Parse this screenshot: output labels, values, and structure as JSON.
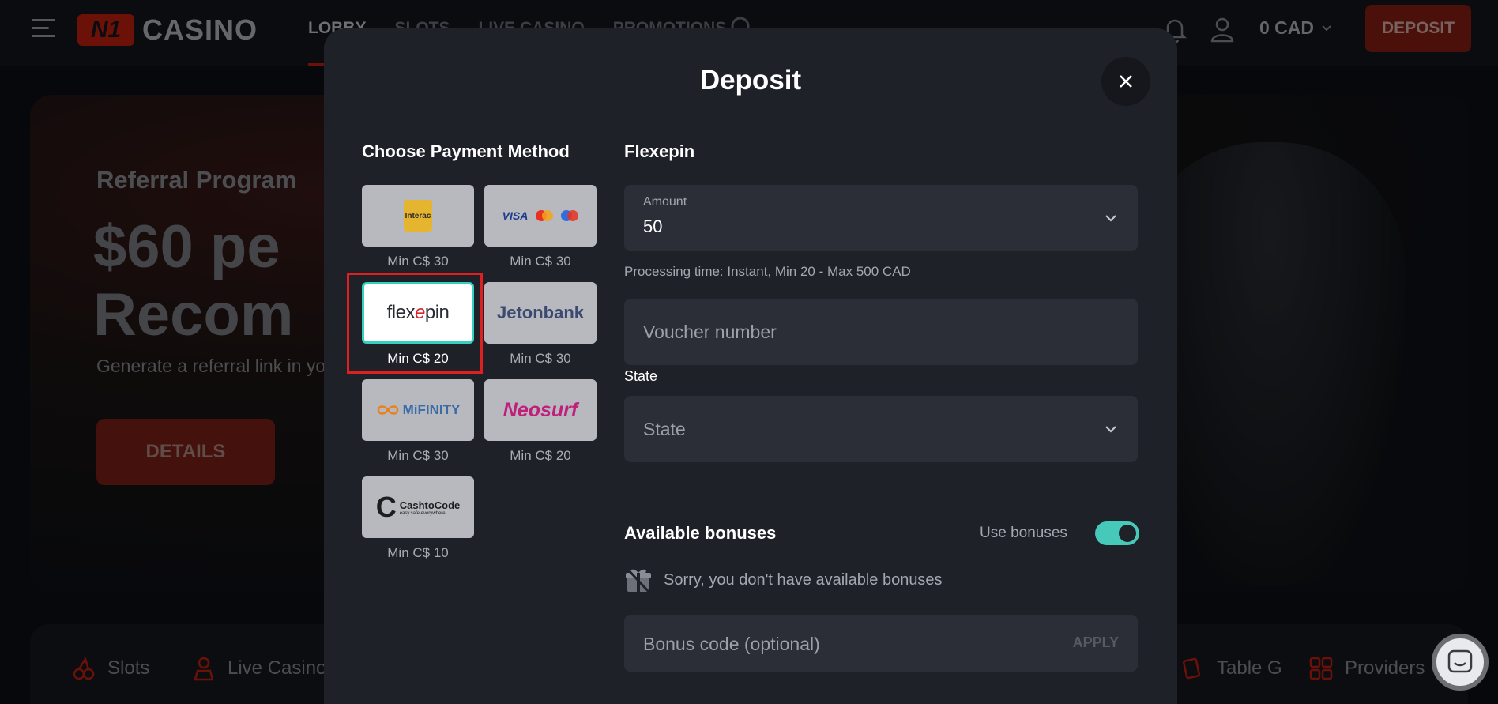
{
  "header": {
    "brand_badge": "N1",
    "brand_text": "CASINO",
    "nav": [
      "LOBBY",
      "SLOTS",
      "LIVE CASINO",
      "PROMOTIONS"
    ],
    "balance": "0 CAD",
    "deposit_label": "DEPOSIT"
  },
  "hero": {
    "kicker": "Referral Program",
    "headline_line1": "$60 pe",
    "headline_line2": "Recom",
    "subtitle": "Generate a referral link in yo",
    "button": "DETAILS"
  },
  "categories": [
    "Slots",
    "Live Casino",
    "Table G",
    "Providers"
  ],
  "modal": {
    "title": "Deposit",
    "choose_title": "Choose Payment Method",
    "methods": [
      {
        "name": "Interac",
        "logo_text": "Interac",
        "min": "Min C$ 30"
      },
      {
        "name": "Visa / Mastercard / Maestro",
        "logo_text": "VISA",
        "min": "Min C$ 30"
      },
      {
        "name": "Flexepin",
        "logo_text_a": "flex",
        "logo_text_b": "e",
        "logo_text_c": "pin",
        "min": "Min C$ 20",
        "selected": true
      },
      {
        "name": "Jetonbank",
        "logo_text": "Jetonbank",
        "min": "Min C$ 30"
      },
      {
        "name": "MiFinity",
        "logo_text": "MiFINITY",
        "min": "Min C$ 30"
      },
      {
        "name": "Neosurf",
        "logo_text": "Neosurf",
        "min": "Min C$ 20"
      },
      {
        "name": "CashtoCode",
        "logo_text": "CashtoCode",
        "logo_sub": "easy.safe.everywhere",
        "min": "Min C$ 10"
      }
    ],
    "method_title": "Flexepin",
    "amount": {
      "label": "Amount",
      "value": "50"
    },
    "processing_time": "Processing time: Instant, Min 20 - Max 500 CAD",
    "voucher_placeholder": "Voucher number",
    "state_label": "State",
    "state_placeholder": "State",
    "bonus": {
      "title": "Available bonuses",
      "use_label": "Use bonuses",
      "use_enabled": true,
      "empty_message": "Sorry, you don't have available bonuses",
      "code_placeholder": "Bonus code (optional)",
      "apply_label": "APPLY"
    }
  },
  "colors": {
    "accent": "#46c9b9",
    "brand_red": "#c4200f",
    "selection_outline": "#e02020"
  }
}
